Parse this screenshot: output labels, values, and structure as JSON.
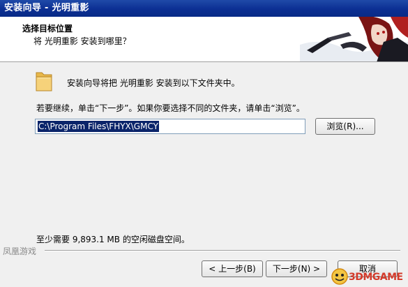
{
  "window": {
    "title": "安装向导 - 光明重影"
  },
  "header": {
    "title": "选择目标位置",
    "subtitle": "将 光明重影 安装到哪里？"
  },
  "body": {
    "intro": "安装向导将把 光明重影 安装到以下文件夹中。",
    "continue_hint": "若要继续，单击“下一步”。如果你要选择不同的文件夹，请单击“浏览”。",
    "path_value": "C:\\Program Files\\FHYX\\GMCY",
    "browse_label": "浏览(R)...",
    "space_required": "至少需要 9,893.1 MB 的空闲磁盘空间。"
  },
  "footer": {
    "brand": "凤凰游戏",
    "back_label": "< 上一步(B)",
    "next_label": "下一步(N) >",
    "cancel_label": "取消"
  },
  "watermark": {
    "text": "3DMGAME"
  },
  "colors": {
    "titlebar": "#0c2f93",
    "selection": "#0a246a",
    "watermark": "#d43a2a"
  },
  "icons": {
    "folder": "folder-icon",
    "banner": "anime-character-banner"
  }
}
